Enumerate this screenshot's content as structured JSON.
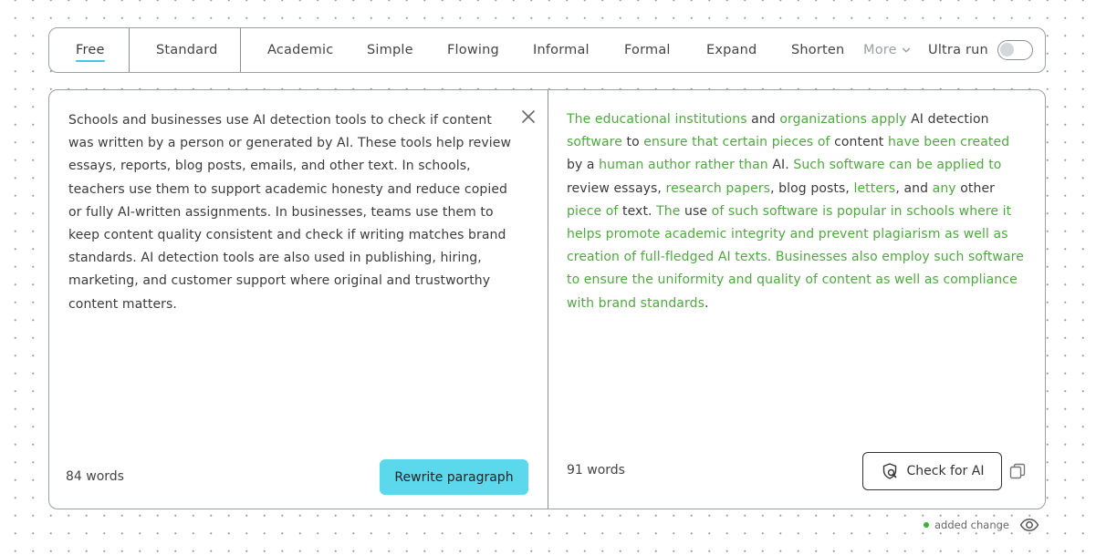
{
  "modes": {
    "free": "Free",
    "standard": "Standard",
    "academic": "Academic",
    "simple": "Simple",
    "flowing": "Flowing",
    "informal": "Informal",
    "formal": "Formal",
    "expand": "Expand",
    "shorten": "Shorten",
    "more": "More",
    "ultra_run": "Ultra run",
    "ultra_run_enabled": false,
    "active": "Free"
  },
  "input": {
    "text": "Schools and businesses use AI detection tools to check if content was written by a person or generated by AI. These tools help review essays, reports, blog posts, emails, and other text. In schools, teachers use them to support academic honesty and reduce copied or fully AI-written assignments. In businesses, teams use them to keep content quality consistent and check if writing matches brand standards. AI detection tools are also used in publishing, hiring, marketing, and customer support where original and trustworthy content matters.",
    "word_count": "84 words",
    "rewrite_label": "Rewrite paragraph"
  },
  "output": {
    "segments": [
      {
        "t": "The educational institutions",
        "c": true
      },
      {
        "t": " and ",
        "c": false
      },
      {
        "t": "organizations apply",
        "c": true
      },
      {
        "t": " AI detection ",
        "c": false
      },
      {
        "t": "software",
        "c": true
      },
      {
        "t": " to ",
        "c": false
      },
      {
        "t": "ensure that certain pieces of",
        "c": true
      },
      {
        "t": " content ",
        "c": false
      },
      {
        "t": "have been created",
        "c": true
      },
      {
        "t": " by a ",
        "c": false
      },
      {
        "t": "human author rather than",
        "c": true
      },
      {
        "t": " AI. ",
        "c": false
      },
      {
        "t": "Such software can be applied to",
        "c": true
      },
      {
        "t": " review essays, ",
        "c": false
      },
      {
        "t": "research papers",
        "c": true
      },
      {
        "t": ", blog posts, ",
        "c": false
      },
      {
        "t": "letters",
        "c": true
      },
      {
        "t": ", and ",
        "c": false
      },
      {
        "t": "any",
        "c": true
      },
      {
        "t": " other ",
        "c": false
      },
      {
        "t": "piece of",
        "c": true
      },
      {
        "t": " text. ",
        "c": false
      },
      {
        "t": "The",
        "c": true
      },
      {
        "t": " use ",
        "c": false
      },
      {
        "t": "of such software is popular in schools where it helps promote academic integrity and prevent plagiarism as well as creation of full-fledged AI texts. Businesses also employ such software to ensure the uniformity and quality of content as well as compliance with brand standards",
        "c": true
      },
      {
        "t": ".",
        "c": false
      }
    ],
    "word_count": "91 words",
    "check_label": "Check for AI"
  },
  "legend": {
    "label": "added change",
    "dot_color": "#3fae35"
  },
  "colors": {
    "accent": "#5cd8ec",
    "change": "#4ea93e",
    "underline": "#45c6e0"
  },
  "icons": {
    "close": "close-icon",
    "more": "chevron-down-icon",
    "check": "shield-search-icon",
    "copy": "copy-icon",
    "legend": "eye-icon"
  }
}
